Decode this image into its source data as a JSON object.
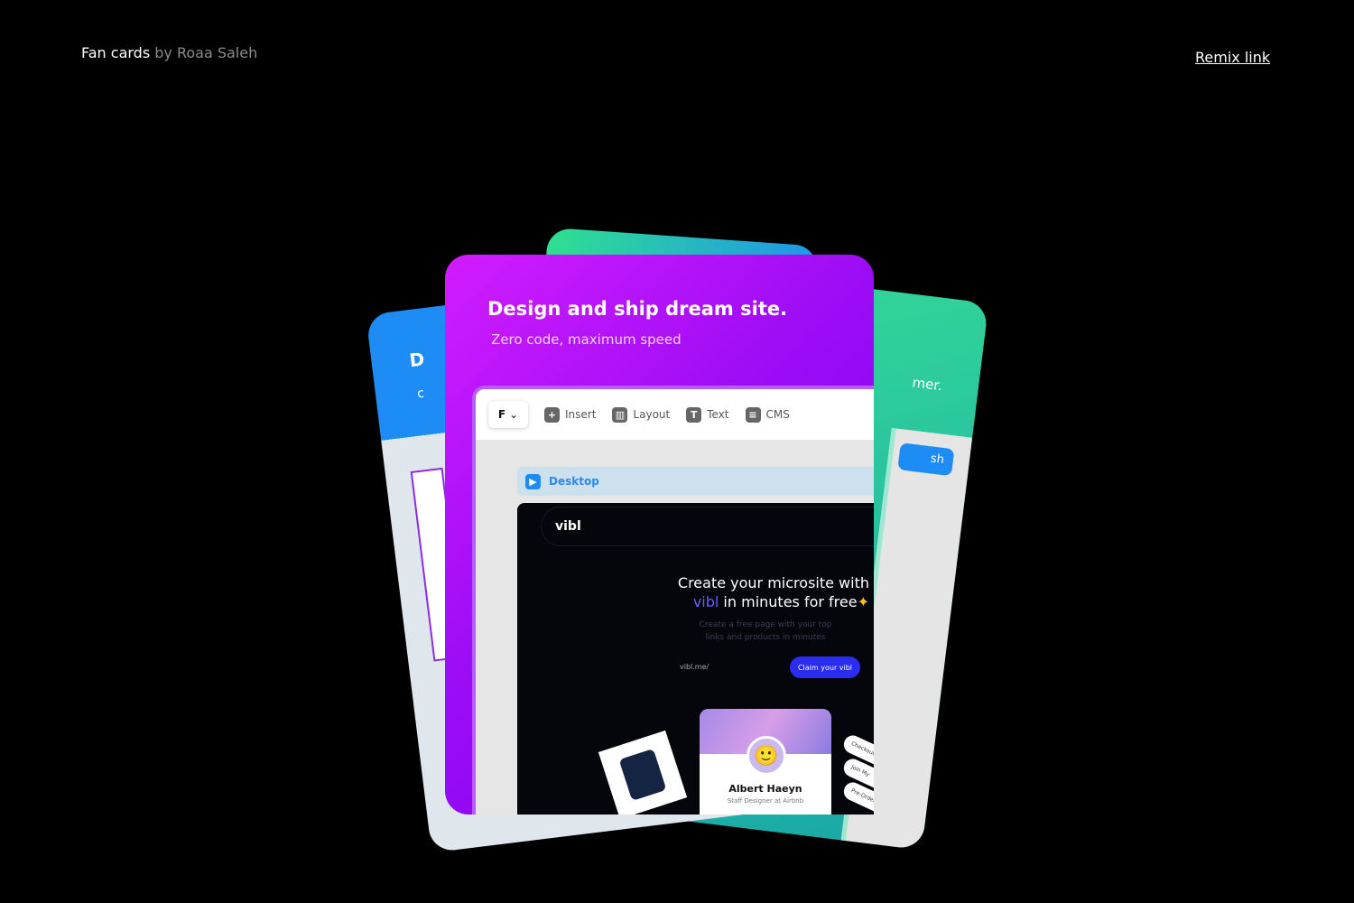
{
  "header": {
    "title": "Fan cards",
    "author": "by Roaa Saleh",
    "remix_link": "Remix link"
  },
  "cards": {
    "left": {
      "title": "D",
      "subtitle": "c"
    },
    "right": {
      "subtitle": "mer.",
      "button": "sh"
    },
    "front": {
      "title": "Design and ship dream site.",
      "subtitle": "Zero code, maximum speed",
      "toolbar": {
        "logo": "F",
        "insert": "Insert",
        "layout": "Layout",
        "text": "Text",
        "cms": "CMS"
      },
      "breakpoint": "Desktop",
      "site": {
        "brand": "vibl",
        "headline_1": "Create your microsite with",
        "headline_brand": "vibl",
        "headline_2": " in minutes for free",
        "description": "Create a free page with your top links and products in minutes",
        "url_prefix": "vibl.me/",
        "cta": "Claim your vibl",
        "profile_name": "Albert Haeyn",
        "profile_role": "Staff Designer at Airbnb",
        "links": [
          "Checkout",
          "Join My",
          "Pre-Order My"
        ]
      }
    }
  }
}
